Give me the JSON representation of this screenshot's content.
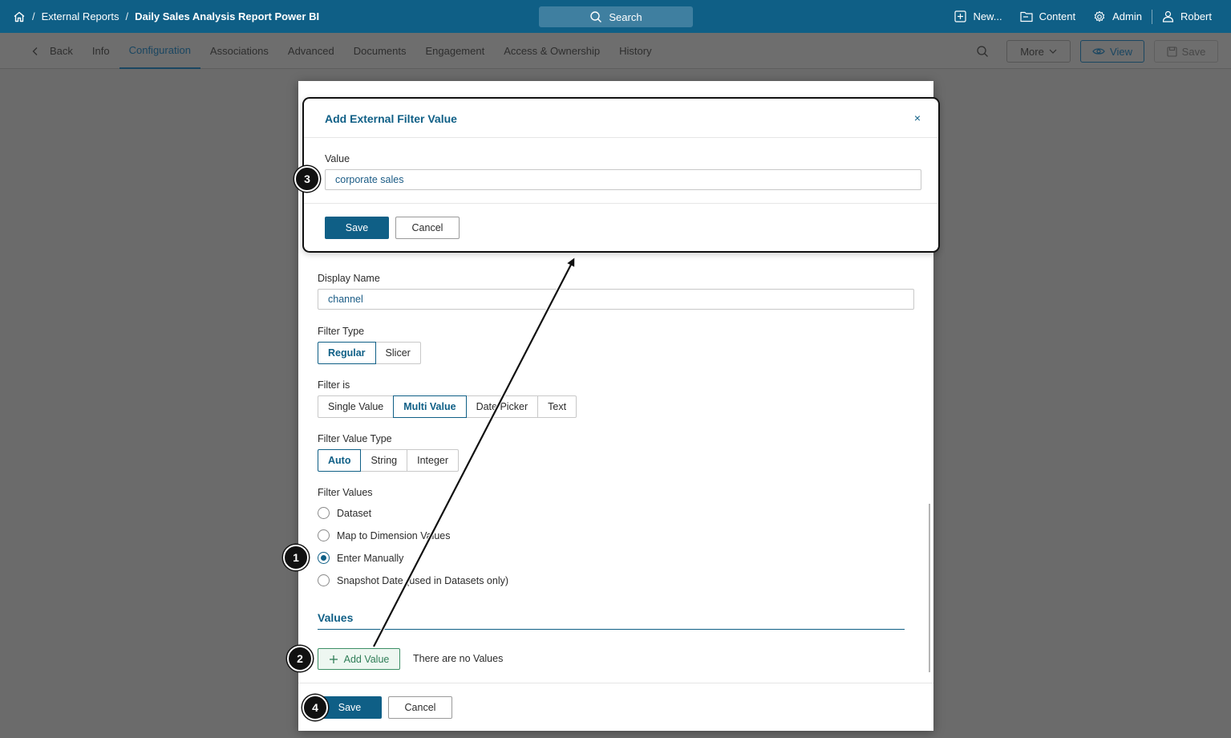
{
  "topbar": {
    "breadcrumb": [
      "External Reports",
      "Daily Sales Analysis Report Power BI"
    ],
    "breadcrumb_sep": "/",
    "search_label": "Search",
    "new_label": "New...",
    "content_label": "Content",
    "admin_label": "Admin",
    "user_label": "Robert"
  },
  "nav": {
    "back_label": "Back",
    "tabs": [
      "Info",
      "Configuration",
      "Associations",
      "Advanced",
      "Documents",
      "Engagement",
      "Access & Ownership",
      "History"
    ],
    "active_tab": "Configuration",
    "more_label": "More",
    "view_label": "View",
    "save_label": "Save"
  },
  "subdialog": {
    "title": "Add External Filter Value",
    "value_label": "Value",
    "value_input": "corporate sales",
    "save_label": "Save",
    "cancel_label": "Cancel",
    "close_glyph": "×"
  },
  "form": {
    "display_name_label": "Display Name",
    "display_name_value": "channel",
    "filter_type_label": "Filter Type",
    "filter_type_options": [
      "Regular",
      "Slicer"
    ],
    "filter_type_selected": "Regular",
    "filter_is_label": "Filter is",
    "filter_is_options": [
      "Single Value",
      "Multi Value",
      "Date Picker",
      "Text"
    ],
    "filter_is_selected": "Multi Value",
    "value_type_label": "Filter Value Type",
    "value_type_options": [
      "Auto",
      "String",
      "Integer"
    ],
    "value_type_selected": "Auto",
    "filter_values_label": "Filter Values",
    "filter_values_options": [
      "Dataset",
      "Map to Dimension Values",
      "Enter Manually",
      "Snapshot Date (used in Datasets only)"
    ],
    "filter_values_selected": "Enter Manually",
    "values_section_title": "Values",
    "add_value_label": "Add Value",
    "empty_values_text": "There are no Values",
    "save_label": "Save",
    "cancel_label": "Cancel"
  },
  "steps": [
    "1",
    "2",
    "3",
    "4"
  ],
  "colors": {
    "brand": "#0f5f86",
    "add_green": "#2f7d57",
    "overlay": "#6b6b6b"
  }
}
